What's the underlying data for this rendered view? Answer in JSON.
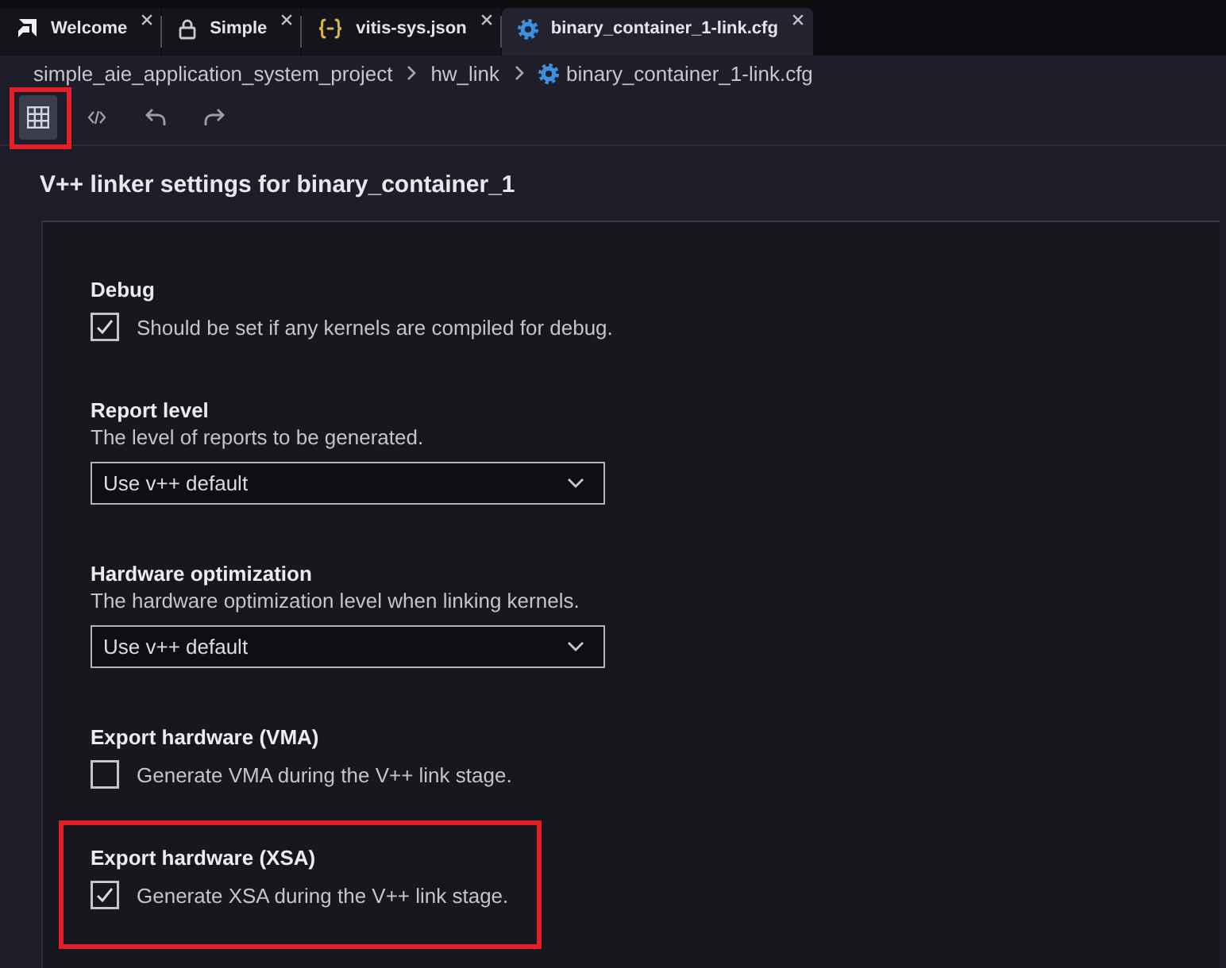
{
  "tabs": [
    {
      "label": "Welcome",
      "kind": "start",
      "selected": false
    },
    {
      "label": "Simple",
      "kind": "project",
      "selected": false
    },
    {
      "label": "vitis-sys.json",
      "kind": "json",
      "selected": false
    },
    {
      "label": "binary_container_1-link.cfg",
      "kind": "config",
      "selected": true
    }
  ],
  "breadcrumb": [
    {
      "label": "simple_aie_application_system_project",
      "kind": "folder"
    },
    {
      "label": "hw_link",
      "kind": "folder"
    },
    {
      "label": "binary_container_1-link.cfg",
      "kind": "file"
    }
  ],
  "toolbar": {
    "view_modes": [
      {
        "kind": "form",
        "selected": true,
        "highlighted": true
      },
      {
        "kind": "source",
        "selected": false,
        "highlighted": false
      }
    ],
    "history": [
      {
        "kind": "undo"
      },
      {
        "kind": "redo"
      }
    ]
  },
  "heading": "V++ linker settings for binary_container_1",
  "settings": [
    {
      "kind": "checkbox",
      "label": "Debug",
      "description": "Should be set if any kernels are compiled for debug.",
      "checked": true,
      "highlighted": false
    },
    {
      "kind": "select",
      "label": "Report level",
      "description": "The level of reports to be generated.",
      "value": "Use v++ default",
      "highlighted": false
    },
    {
      "kind": "select",
      "label": "Hardware optimization",
      "description": "The hardware optimization level when linking kernels.",
      "value": "Use v++ default",
      "highlighted": false
    },
    {
      "kind": "checkbox",
      "label": "Export hardware (VMA)",
      "description": "Generate VMA during the V++ link stage.",
      "checked": false,
      "highlighted": false
    },
    {
      "kind": "checkbox",
      "label": "Export hardware (XSA)",
      "description": "Generate XSA during the V++ link stage.",
      "checked": true,
      "highlighted": true
    }
  ]
}
